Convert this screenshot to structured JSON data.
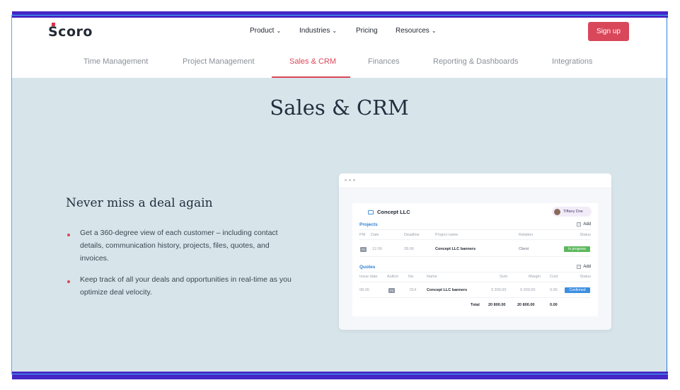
{
  "header": {
    "logo": "Scoro",
    "nav": [
      {
        "label": "Product",
        "has_dropdown": true
      },
      {
        "label": "Industries",
        "has_dropdown": true
      },
      {
        "label": "Pricing",
        "has_dropdown": false
      },
      {
        "label": "Resources",
        "has_dropdown": true
      }
    ],
    "signup_label": "Sign up",
    "chevron": "⌄"
  },
  "subnav": {
    "items": [
      {
        "label": "Time Management"
      },
      {
        "label": "Project Management"
      },
      {
        "label": "Sales & CRM",
        "active": true
      },
      {
        "label": "Finances"
      },
      {
        "label": "Reporting & Dashboards"
      },
      {
        "label": "Integrations"
      }
    ]
  },
  "hero": {
    "title": "Sales & CRM"
  },
  "feature": {
    "title": "Never miss a deal again",
    "bullets": [
      "Get a 360-degree view of each customer – including contact details, communication history, projects, files, quotes, and invoices.",
      "Keep track of all your deals and opportunities in real-time as you optimize deal velocity."
    ]
  },
  "mockup": {
    "company": "Concept LLC",
    "user": "Tiffany Doe",
    "add_label": "Add",
    "projects": {
      "label": "Projects",
      "columns": [
        "PM",
        "Date",
        "Deadline",
        "Project name",
        "Relation",
        "Status"
      ],
      "rows": [
        {
          "pm": "PS",
          "date": "12.06",
          "deadline": "28.06",
          "name": "Concept LLC banners",
          "relation": "Client",
          "status": "In progress"
        }
      ]
    },
    "quotes": {
      "label": "Quotes",
      "columns": [
        "Issue date",
        "Author",
        "No.",
        "Name",
        "Sum",
        "Margin",
        "Cost",
        "Status"
      ],
      "rows": [
        {
          "issue_date": "08.06",
          "author": "PS",
          "no": "014",
          "name": "Concept LLC banners",
          "sum": "9 200.00",
          "margin": "9 200.00",
          "cost": "0.00",
          "status": "Confirmed"
        }
      ],
      "total": {
        "label": "Total",
        "sum": "20 800.00",
        "margin": "20 800.00",
        "cost": "0.00"
      }
    }
  },
  "colors": {
    "accent": "#d9475a",
    "background": "#d7e5ea",
    "frame": "#4527c6",
    "status_in_progress": "#5cb85c",
    "status_confirmed": "#3d8fe0",
    "link_blue": "#2d7fd3"
  }
}
